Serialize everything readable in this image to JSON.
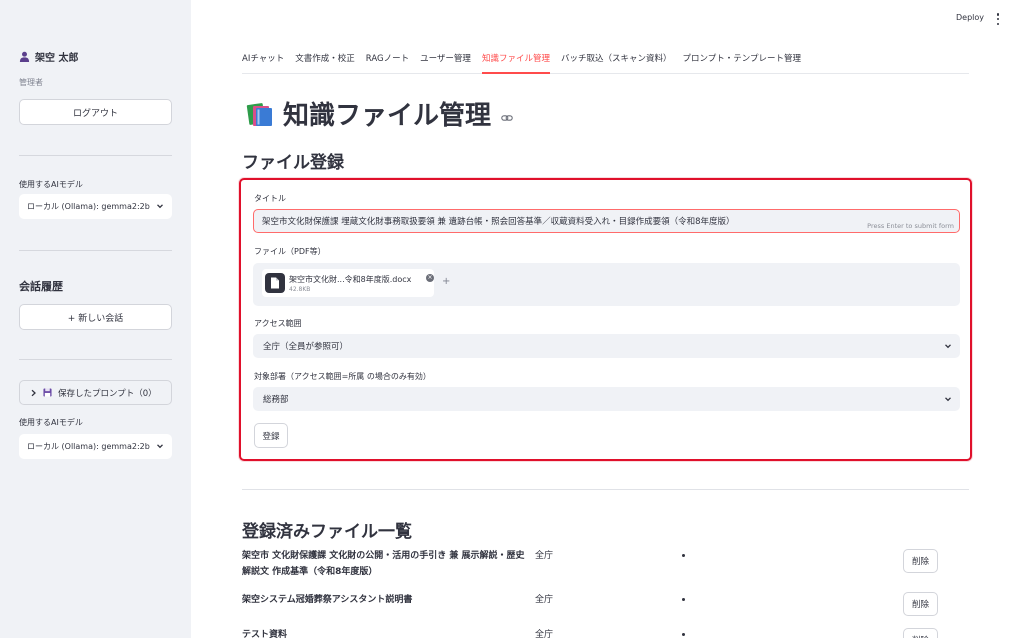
{
  "sidebar": {
    "user_name": "架空 太郎",
    "role": "管理者",
    "logout_label": "ログアウト",
    "model_label_1": "使用するAIモデル",
    "model_value_1": "ローカル (Ollama): gemma2:2b",
    "history_heading": "会話履歴",
    "new_chat_label": "+ 新しい会話",
    "saved_prompts_label": "保存したプロンプト（0）",
    "model_label_2": "使用するAIモデル",
    "model_value_2": "ローカル (Ollama): gemma2:2b"
  },
  "topbar": {
    "deploy_label": "Deploy"
  },
  "tabs": [
    {
      "label": "AIチャット",
      "active": false
    },
    {
      "label": "文書作成・校正",
      "active": false
    },
    {
      "label": "RAGノート",
      "active": false
    },
    {
      "label": "ユーザー管理",
      "active": false
    },
    {
      "label": "知識ファイル管理",
      "active": true
    },
    {
      "label": "バッチ取込（スキャン資料）",
      "active": false
    },
    {
      "label": "プロンプト・テンプレート管理",
      "active": false
    }
  ],
  "page": {
    "title": "知識ファイル管理",
    "section_title": "ファイル登録",
    "list_title": "登録済みファイル一覧"
  },
  "form": {
    "title_label": "タイトル",
    "title_value": "架空市文化財保護課 埋蔵文化財事務取扱要領 兼 遺跡台帳・照会回答基準／収蔵資料受入れ・目録作成要領（令和8年度版）",
    "enter_hint": "Press Enter to submit form",
    "file_label": "ファイル（PDF等）",
    "file_name": "架空市文化財...令和8年度版.docx",
    "file_size": "42.8KB",
    "access_label": "アクセス範囲",
    "access_value": "全庁（全員が参照可）",
    "dept_label": "対象部署（アクセス範囲=所属 の場合のみ有効）",
    "dept_value": "総務部",
    "submit_label": "登録"
  },
  "files": [
    {
      "name": "架空市 文化財保護課 文化財の公開・活用の手引き 兼 展示解説・歴史解説文 作成基準（令和8年度版）",
      "access": "全庁",
      "delete_label": "削除"
    },
    {
      "name": "架空システム冠婚葬祭アシスタント説明書",
      "access": "全庁",
      "delete_label": "削除"
    },
    {
      "name": "テスト資料",
      "access": "全庁",
      "delete_label": "削除"
    }
  ],
  "colors": {
    "accent": "#ff4b4b",
    "focus_border": "#e0102b",
    "sidebar_bg": "#f0f2f6"
  }
}
